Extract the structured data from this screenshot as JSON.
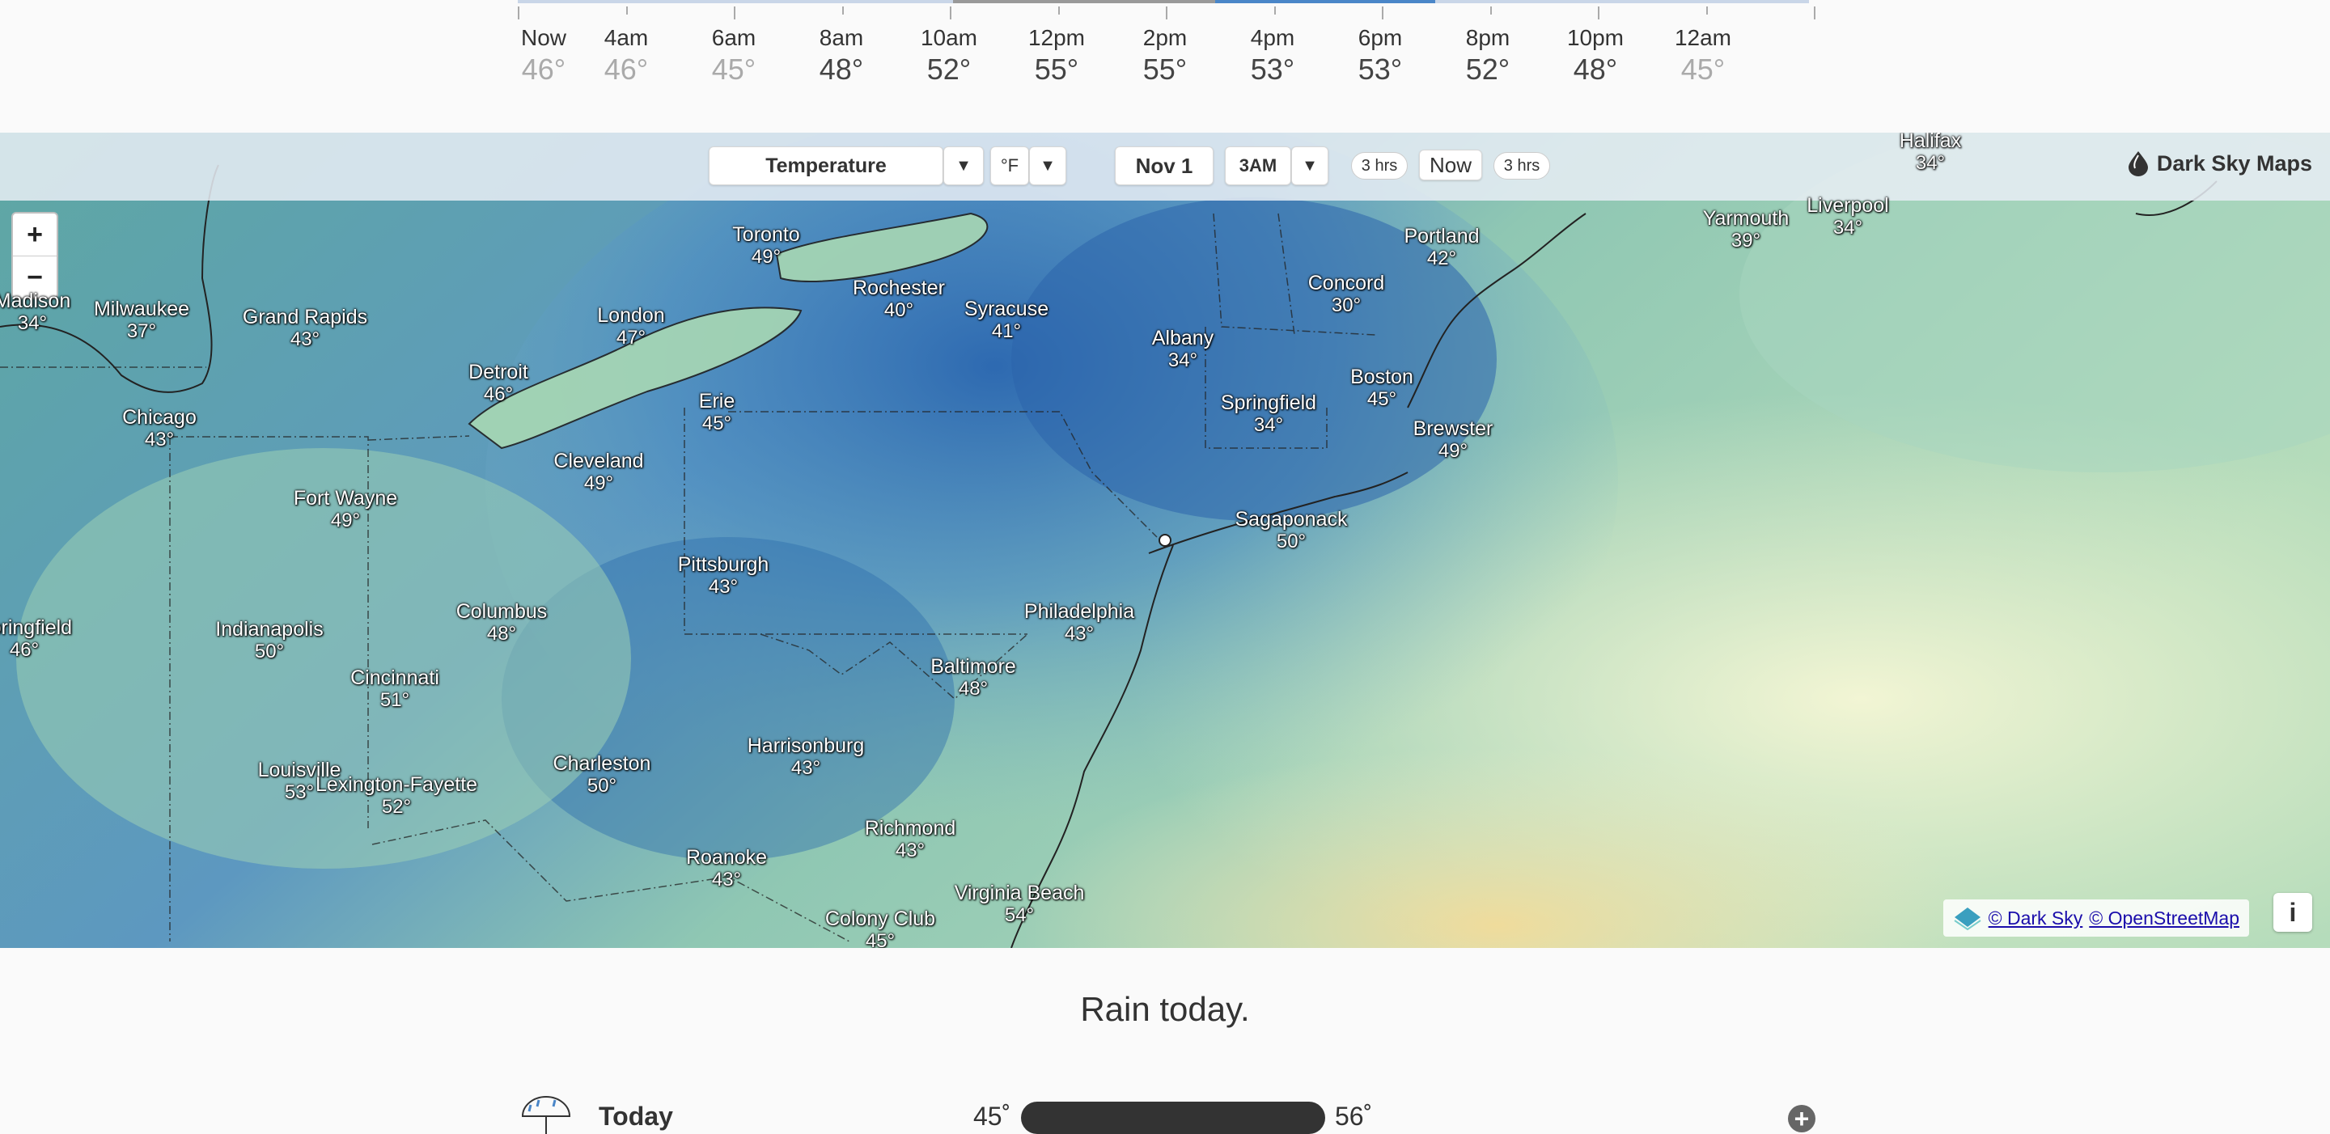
{
  "hourly": {
    "items": [
      {
        "time": "Now",
        "temp": "46°",
        "future": false
      },
      {
        "time": "4am",
        "temp": "46°",
        "future": false
      },
      {
        "time": "6am",
        "temp": "45°",
        "future": false
      },
      {
        "time": "8am",
        "temp": "48°",
        "future": true
      },
      {
        "time": "10am",
        "temp": "52°",
        "future": true
      },
      {
        "time": "12pm",
        "temp": "55°",
        "future": true
      },
      {
        "time": "2pm",
        "temp": "55°",
        "future": true
      },
      {
        "time": "4pm",
        "temp": "53°",
        "future": true
      },
      {
        "time": "6pm",
        "temp": "53°",
        "future": true
      },
      {
        "time": "8pm",
        "temp": "52°",
        "future": true
      },
      {
        "time": "10pm",
        "temp": "48°",
        "future": true
      },
      {
        "time": "12am",
        "temp": "45°",
        "future": false
      }
    ]
  },
  "map_controls": {
    "layer": "Temperature",
    "unit": "°F",
    "date": "Nov 1",
    "time": "3AM",
    "back": "3 hrs",
    "now": "Now",
    "forward": "3 hrs",
    "brand": "Dark Sky Maps",
    "zoom_in": "+",
    "zoom_out": "−",
    "info": "i"
  },
  "attribution": {
    "darksky": "© Dark Sky",
    "osm": "© OpenStreetMap"
  },
  "cities": [
    {
      "name": "Toronto",
      "temp": "49°"
    },
    {
      "name": "Rochester",
      "temp": "40°"
    },
    {
      "name": "Syracuse",
      "temp": "41°"
    },
    {
      "name": "Portland",
      "temp": "42°"
    },
    {
      "name": "Yarmouth",
      "temp": "39°"
    },
    {
      "name": "Liverpool",
      "temp": "34°"
    },
    {
      "name": "Halifax",
      "temp": "34°"
    },
    {
      "name": "Concord",
      "temp": "30°"
    },
    {
      "name": "Albany",
      "temp": "34°"
    },
    {
      "name": "Boston",
      "temp": "45°"
    },
    {
      "name": "Springfield",
      "temp": "34°"
    },
    {
      "name": "Brewster",
      "temp": "49°"
    },
    {
      "name": "Milwaukee",
      "temp": "37°"
    },
    {
      "name": "Madison",
      "temp": "34°"
    },
    {
      "name": "Grand Rapids",
      "temp": "43°"
    },
    {
      "name": "London",
      "temp": "47°"
    },
    {
      "name": "Detroit",
      "temp": "46°"
    },
    {
      "name": "Chicago",
      "temp": "43°"
    },
    {
      "name": "Erie",
      "temp": "45°"
    },
    {
      "name": "Cleveland",
      "temp": "49°"
    },
    {
      "name": "Fort Wayne",
      "temp": "49°"
    },
    {
      "name": "Sagaponack",
      "temp": "50°"
    },
    {
      "name": "Pittsburgh",
      "temp": "43°"
    },
    {
      "name": "Columbus",
      "temp": "48°"
    },
    {
      "name": "Springfield",
      "temp": "46°"
    },
    {
      "name": "Indianapolis",
      "temp": "50°"
    },
    {
      "name": "Philadelphia",
      "temp": "43°"
    },
    {
      "name": "Baltimore",
      "temp": "48°"
    },
    {
      "name": "Cincinnati",
      "temp": "51°"
    },
    {
      "name": "Charleston",
      "temp": "50°"
    },
    {
      "name": "Harrisonburg",
      "temp": "43°"
    },
    {
      "name": "Louisville",
      "temp": "53°"
    },
    {
      "name": "Lexington-Fayette",
      "temp": "52°"
    },
    {
      "name": "Richmond",
      "temp": "43°"
    },
    {
      "name": "Roanoke",
      "temp": "43°"
    },
    {
      "name": "Virginia Beach",
      "temp": "54°"
    },
    {
      "name": "Colony Club",
      "temp": "45°"
    }
  ],
  "summary": "Rain today.",
  "daily": {
    "label": "Today",
    "low": "45˚",
    "high": "56˚",
    "plus": "+"
  },
  "colors": {
    "map_blue": "#2f6fb0",
    "map_green": "#a9d3b1",
    "map_yellow": "#efe2a8",
    "accent": "#4a86c8"
  }
}
